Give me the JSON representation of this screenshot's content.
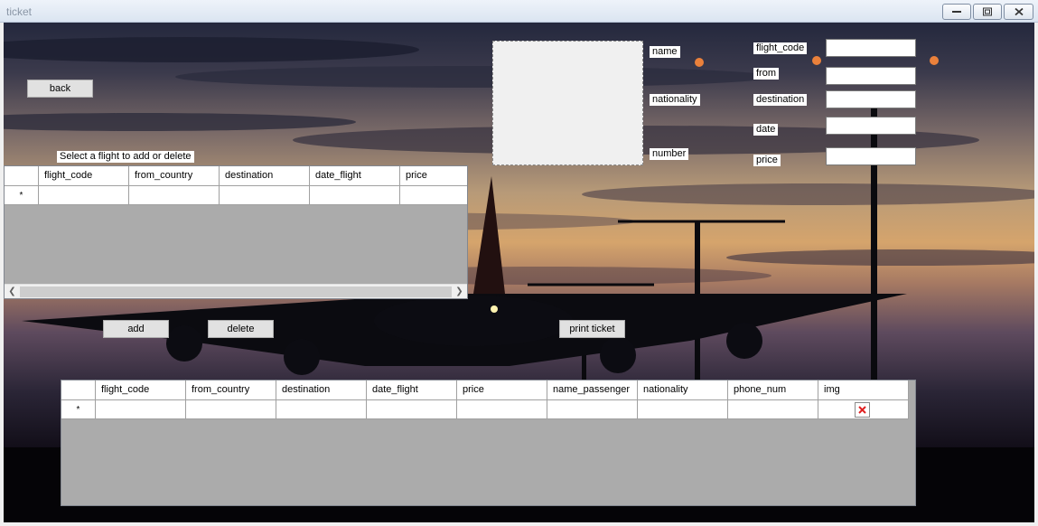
{
  "window": {
    "title": "ticket"
  },
  "buttons": {
    "back": "back",
    "add": "add",
    "delete": "delete",
    "print": "print ticket"
  },
  "hint": "Select a flight to add or delete",
  "passenger_labels": {
    "name": "name",
    "nationality": "nationality",
    "number": "number"
  },
  "flight_form": {
    "flight_code_label": "flight_code",
    "from_label": "from",
    "destination_label": "destination",
    "date_label": "date",
    "price_label": "price",
    "flight_code_value": "",
    "from_value": "",
    "destination_value": "",
    "date_value": "",
    "price_value": ""
  },
  "flights_grid": {
    "columns": [
      "flight_code",
      "from_country",
      "destination",
      "date_flight",
      "price"
    ],
    "new_row_marker": "*"
  },
  "tickets_grid": {
    "columns": [
      "flight_code",
      "from_country",
      "destination",
      "date_flight",
      "price",
      "name_passenger",
      "nationality",
      "phone_num",
      "img"
    ],
    "new_row_marker": "*"
  }
}
